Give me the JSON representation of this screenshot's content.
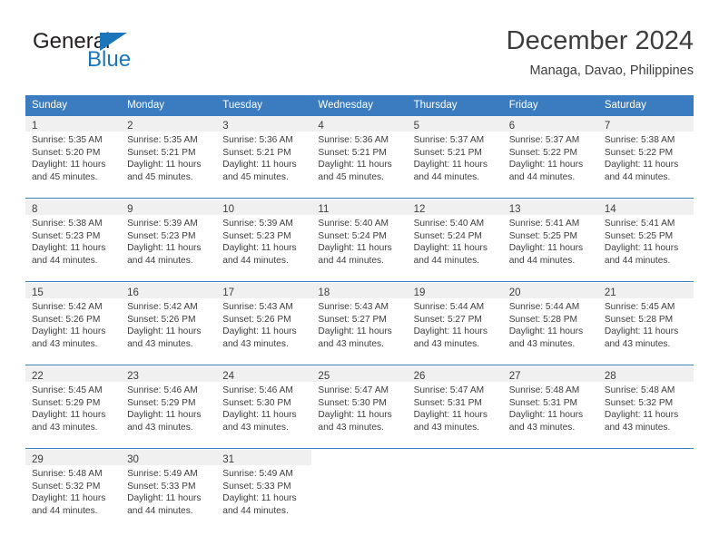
{
  "brand": {
    "name_top": "General",
    "name_bottom": "Blue",
    "accent_color": "#1b75bb"
  },
  "header": {
    "title": "December 2024",
    "location": "Managa, Davao, Philippines"
  },
  "theme": {
    "header_row_bg": "#3b7cc0",
    "daynum_band_bg": "#f0f0f0",
    "text_color": "#3d3d3d"
  },
  "weekday_headers": [
    "Sunday",
    "Monday",
    "Tuesday",
    "Wednesday",
    "Thursday",
    "Friday",
    "Saturday"
  ],
  "labels": {
    "sunrise_prefix": "Sunrise:",
    "sunset_prefix": "Sunset:",
    "daylight_prefix": "Daylight:"
  },
  "weeks": [
    [
      {
        "day": "1",
        "sunrise": "Sunrise: 5:35 AM",
        "sunset": "Sunset: 5:20 PM",
        "daylight_line1": "Daylight: 11 hours",
        "daylight_line2": "and 45 minutes."
      },
      {
        "day": "2",
        "sunrise": "Sunrise: 5:35 AM",
        "sunset": "Sunset: 5:21 PM",
        "daylight_line1": "Daylight: 11 hours",
        "daylight_line2": "and 45 minutes."
      },
      {
        "day": "3",
        "sunrise": "Sunrise: 5:36 AM",
        "sunset": "Sunset: 5:21 PM",
        "daylight_line1": "Daylight: 11 hours",
        "daylight_line2": "and 45 minutes."
      },
      {
        "day": "4",
        "sunrise": "Sunrise: 5:36 AM",
        "sunset": "Sunset: 5:21 PM",
        "daylight_line1": "Daylight: 11 hours",
        "daylight_line2": "and 45 minutes."
      },
      {
        "day": "5",
        "sunrise": "Sunrise: 5:37 AM",
        "sunset": "Sunset: 5:21 PM",
        "daylight_line1": "Daylight: 11 hours",
        "daylight_line2": "and 44 minutes."
      },
      {
        "day": "6",
        "sunrise": "Sunrise: 5:37 AM",
        "sunset": "Sunset: 5:22 PM",
        "daylight_line1": "Daylight: 11 hours",
        "daylight_line2": "and 44 minutes."
      },
      {
        "day": "7",
        "sunrise": "Sunrise: 5:38 AM",
        "sunset": "Sunset: 5:22 PM",
        "daylight_line1": "Daylight: 11 hours",
        "daylight_line2": "and 44 minutes."
      }
    ],
    [
      {
        "day": "8",
        "sunrise": "Sunrise: 5:38 AM",
        "sunset": "Sunset: 5:23 PM",
        "daylight_line1": "Daylight: 11 hours",
        "daylight_line2": "and 44 minutes."
      },
      {
        "day": "9",
        "sunrise": "Sunrise: 5:39 AM",
        "sunset": "Sunset: 5:23 PM",
        "daylight_line1": "Daylight: 11 hours",
        "daylight_line2": "and 44 minutes."
      },
      {
        "day": "10",
        "sunrise": "Sunrise: 5:39 AM",
        "sunset": "Sunset: 5:23 PM",
        "daylight_line1": "Daylight: 11 hours",
        "daylight_line2": "and 44 minutes."
      },
      {
        "day": "11",
        "sunrise": "Sunrise: 5:40 AM",
        "sunset": "Sunset: 5:24 PM",
        "daylight_line1": "Daylight: 11 hours",
        "daylight_line2": "and 44 minutes."
      },
      {
        "day": "12",
        "sunrise": "Sunrise: 5:40 AM",
        "sunset": "Sunset: 5:24 PM",
        "daylight_line1": "Daylight: 11 hours",
        "daylight_line2": "and 44 minutes."
      },
      {
        "day": "13",
        "sunrise": "Sunrise: 5:41 AM",
        "sunset": "Sunset: 5:25 PM",
        "daylight_line1": "Daylight: 11 hours",
        "daylight_line2": "and 44 minutes."
      },
      {
        "day": "14",
        "sunrise": "Sunrise: 5:41 AM",
        "sunset": "Sunset: 5:25 PM",
        "daylight_line1": "Daylight: 11 hours",
        "daylight_line2": "and 44 minutes."
      }
    ],
    [
      {
        "day": "15",
        "sunrise": "Sunrise: 5:42 AM",
        "sunset": "Sunset: 5:26 PM",
        "daylight_line1": "Daylight: 11 hours",
        "daylight_line2": "and 43 minutes."
      },
      {
        "day": "16",
        "sunrise": "Sunrise: 5:42 AM",
        "sunset": "Sunset: 5:26 PM",
        "daylight_line1": "Daylight: 11 hours",
        "daylight_line2": "and 43 minutes."
      },
      {
        "day": "17",
        "sunrise": "Sunrise: 5:43 AM",
        "sunset": "Sunset: 5:26 PM",
        "daylight_line1": "Daylight: 11 hours",
        "daylight_line2": "and 43 minutes."
      },
      {
        "day": "18",
        "sunrise": "Sunrise: 5:43 AM",
        "sunset": "Sunset: 5:27 PM",
        "daylight_line1": "Daylight: 11 hours",
        "daylight_line2": "and 43 minutes."
      },
      {
        "day": "19",
        "sunrise": "Sunrise: 5:44 AM",
        "sunset": "Sunset: 5:27 PM",
        "daylight_line1": "Daylight: 11 hours",
        "daylight_line2": "and 43 minutes."
      },
      {
        "day": "20",
        "sunrise": "Sunrise: 5:44 AM",
        "sunset": "Sunset: 5:28 PM",
        "daylight_line1": "Daylight: 11 hours",
        "daylight_line2": "and 43 minutes."
      },
      {
        "day": "21",
        "sunrise": "Sunrise: 5:45 AM",
        "sunset": "Sunset: 5:28 PM",
        "daylight_line1": "Daylight: 11 hours",
        "daylight_line2": "and 43 minutes."
      }
    ],
    [
      {
        "day": "22",
        "sunrise": "Sunrise: 5:45 AM",
        "sunset": "Sunset: 5:29 PM",
        "daylight_line1": "Daylight: 11 hours",
        "daylight_line2": "and 43 minutes."
      },
      {
        "day": "23",
        "sunrise": "Sunrise: 5:46 AM",
        "sunset": "Sunset: 5:29 PM",
        "daylight_line1": "Daylight: 11 hours",
        "daylight_line2": "and 43 minutes."
      },
      {
        "day": "24",
        "sunrise": "Sunrise: 5:46 AM",
        "sunset": "Sunset: 5:30 PM",
        "daylight_line1": "Daylight: 11 hours",
        "daylight_line2": "and 43 minutes."
      },
      {
        "day": "25",
        "sunrise": "Sunrise: 5:47 AM",
        "sunset": "Sunset: 5:30 PM",
        "daylight_line1": "Daylight: 11 hours",
        "daylight_line2": "and 43 minutes."
      },
      {
        "day": "26",
        "sunrise": "Sunrise: 5:47 AM",
        "sunset": "Sunset: 5:31 PM",
        "daylight_line1": "Daylight: 11 hours",
        "daylight_line2": "and 43 minutes."
      },
      {
        "day": "27",
        "sunrise": "Sunrise: 5:48 AM",
        "sunset": "Sunset: 5:31 PM",
        "daylight_line1": "Daylight: 11 hours",
        "daylight_line2": "and 43 minutes."
      },
      {
        "day": "28",
        "sunrise": "Sunrise: 5:48 AM",
        "sunset": "Sunset: 5:32 PM",
        "daylight_line1": "Daylight: 11 hours",
        "daylight_line2": "and 43 minutes."
      }
    ],
    [
      {
        "day": "29",
        "sunrise": "Sunrise: 5:48 AM",
        "sunset": "Sunset: 5:32 PM",
        "daylight_line1": "Daylight: 11 hours",
        "daylight_line2": "and 44 minutes."
      },
      {
        "day": "30",
        "sunrise": "Sunrise: 5:49 AM",
        "sunset": "Sunset: 5:33 PM",
        "daylight_line1": "Daylight: 11 hours",
        "daylight_line2": "and 44 minutes."
      },
      {
        "day": "31",
        "sunrise": "Sunrise: 5:49 AM",
        "sunset": "Sunset: 5:33 PM",
        "daylight_line1": "Daylight: 11 hours",
        "daylight_line2": "and 44 minutes."
      },
      {
        "day": "",
        "sunrise": "",
        "sunset": "",
        "daylight_line1": "",
        "daylight_line2": ""
      },
      {
        "day": "",
        "sunrise": "",
        "sunset": "",
        "daylight_line1": "",
        "daylight_line2": ""
      },
      {
        "day": "",
        "sunrise": "",
        "sunset": "",
        "daylight_line1": "",
        "daylight_line2": ""
      },
      {
        "day": "",
        "sunrise": "",
        "sunset": "",
        "daylight_line1": "",
        "daylight_line2": ""
      }
    ]
  ]
}
